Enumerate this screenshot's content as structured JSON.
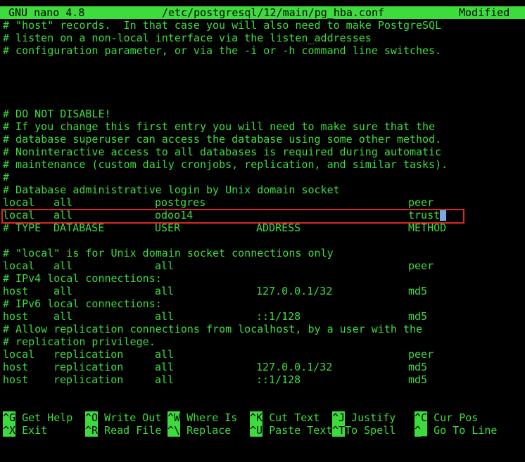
{
  "title_bar": {
    "app": "GNU nano 4.8",
    "file": "/etc/postgresql/12/main/pg_hba.conf",
    "status": "Modified"
  },
  "lines": [
    "# \"host\" records.  In that case you will also need to make PostgreSQL",
    "# listen on a non-local interface via the listen_addresses",
    "# configuration parameter, or via the -i or -h command line switches.",
    "",
    "",
    "",
    "",
    "# DO NOT DISABLE!",
    "# If you change this first entry you will need to make sure that the",
    "# database superuser can access the database using some other method.",
    "# Noninteractive access to all databases is required during automatic",
    "# maintenance (custom daily cronjobs, replication, and similar tasks).",
    "#",
    "# Database administrative login by Unix domain socket"
  ],
  "records": [
    {
      "c0": "local",
      "c1": "all",
      "c2": "postgres",
      "c3": "",
      "c4": "peer"
    },
    {
      "c0": "local",
      "c1": "all",
      "c2": "odoo14",
      "c3": "",
      "c4": "trust"
    },
    {
      "c0": "# TYPE",
      "c1": "DATABASE",
      "c2": "USER",
      "c3": "ADDRESS",
      "c4": "METHOD"
    }
  ],
  "lines2": [
    "",
    "# \"local\" is for Unix domain socket connections only"
  ],
  "records2": [
    {
      "c0": "local",
      "c1": "all",
      "c2": "all",
      "c3": "",
      "c4": "peer"
    }
  ],
  "comment_ipv4": "# IPv4 local connections:",
  "record_ipv4": {
    "c0": "host",
    "c1": "all",
    "c2": "all",
    "c3": "127.0.0.1/32",
    "c4": "md5"
  },
  "comment_ipv6": "# IPv6 local connections:",
  "record_ipv6": {
    "c0": "host",
    "c1": "all",
    "c2": "all",
    "c3": "::1/128",
    "c4": "md5"
  },
  "comment_repl_1": "# Allow replication connections from localhost, by a user with the",
  "comment_repl_2": "# replication privilege.",
  "records_repl": [
    {
      "c0": "local",
      "c1": "replication",
      "c2": "all",
      "c3": "",
      "c4": "peer"
    },
    {
      "c0": "host",
      "c1": "replication",
      "c2": "all",
      "c3": "127.0.0.1/32",
      "c4": "md5"
    },
    {
      "c0": "host",
      "c1": "replication",
      "c2": "all",
      "c3": "::1/128",
      "c4": "md5"
    }
  ],
  "shortcuts": [
    {
      "key": "^G",
      "label": "Get Help"
    },
    {
      "key": "^O",
      "label": "Write Out"
    },
    {
      "key": "^W",
      "label": "Where Is"
    },
    {
      "key": "^K",
      "label": "Cut Text"
    },
    {
      "key": "^J",
      "label": "Justify"
    },
    {
      "key": "^C",
      "label": "Cur Pos"
    },
    {
      "key": "^X",
      "label": "Exit"
    },
    {
      "key": "^R",
      "label": "Read File"
    },
    {
      "key": "^\\",
      "label": "Replace"
    },
    {
      "key": "^U",
      "label": "Paste Text"
    },
    {
      "key": "^T",
      "label": "To Spell"
    },
    {
      "key": "^_",
      "label": "Go To Line"
    }
  ],
  "colors": {
    "text": "#3ddc3d",
    "background": "#000000",
    "highlight_border": "#e02424",
    "cursor": "#7aa7e6"
  }
}
